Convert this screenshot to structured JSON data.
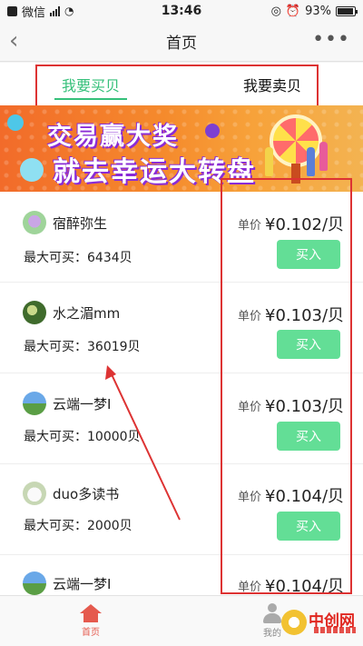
{
  "status_bar": {
    "carrier": "微信",
    "time": "13:46",
    "battery": "93%",
    "battery_level": 0.93
  },
  "nav": {
    "title": "首页",
    "back_icon": "chevron-left-icon",
    "more_icon": "more-dots-icon"
  },
  "tabs": [
    {
      "label": "我要买贝",
      "active": true
    },
    {
      "label": "我要卖贝",
      "active": false
    }
  ],
  "banner": {
    "line1": "交易赢大奖",
    "line2": "就去幸运大转盘"
  },
  "listings": [
    {
      "name": "宿醉弥生",
      "max_label": "最大可买：6434贝",
      "price_label": "单价",
      "price": "¥0.102/贝",
      "button": "买入"
    },
    {
      "name": "水之湄mm",
      "max_label": "最大可买：36019贝",
      "price_label": "单价",
      "price": "¥0.103/贝",
      "button": "买入"
    },
    {
      "name": "云端一梦I",
      "max_label": "最大可买：10000贝",
      "price_label": "单价",
      "price": "¥0.103/贝",
      "button": "买入"
    },
    {
      "name": "duo多读书",
      "max_label": "最大可买：2000贝",
      "price_label": "单价",
      "price": "¥0.104/贝",
      "button": "买入"
    },
    {
      "name": "云端一梦I",
      "max_label": "",
      "price_label": "单价",
      "price": "¥0.104/贝",
      "button": ""
    }
  ],
  "bottom_tabs": [
    {
      "label": "首页",
      "icon": "home-icon",
      "active": true
    },
    {
      "label": "我的",
      "icon": "user-icon",
      "active": false
    }
  ],
  "watermark": {
    "text": "中创网"
  },
  "colors": {
    "accent_green": "#35c07a",
    "buy_button": "#63de96",
    "annotation_red": "#d33",
    "home_active": "#e55a4e"
  }
}
